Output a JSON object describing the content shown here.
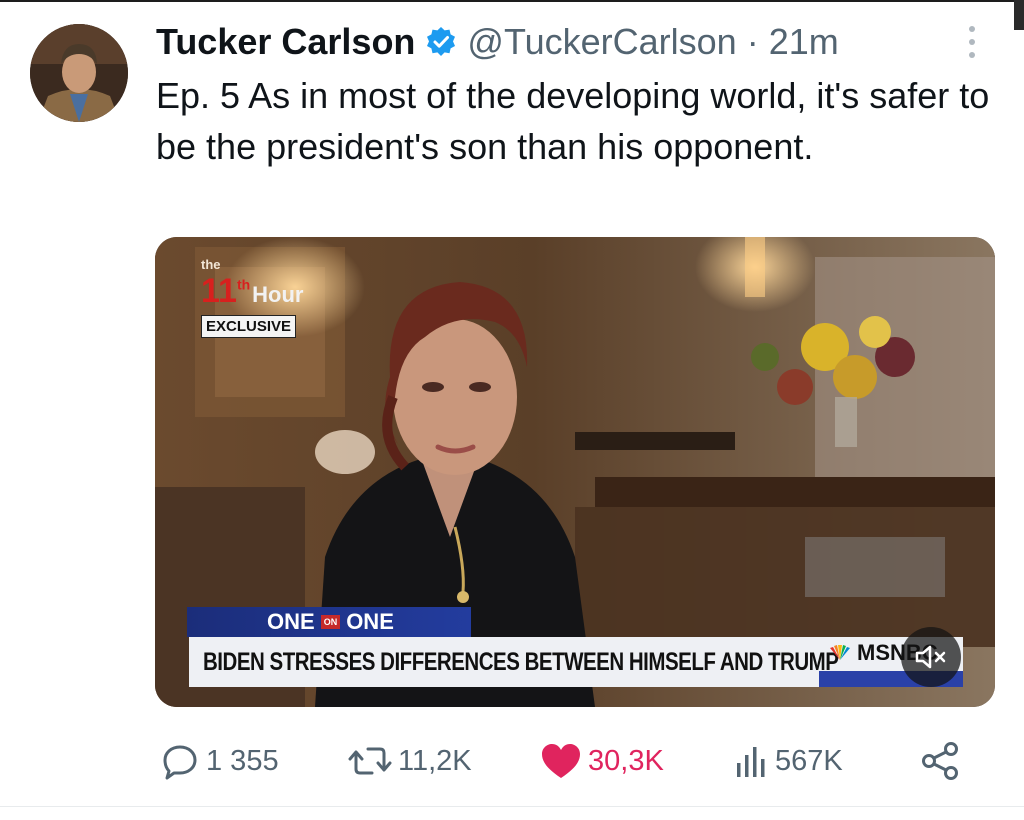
{
  "tweet": {
    "author_name": "Tucker Carlson",
    "handle_time": "@TuckerCarlson · 21m",
    "text": "Ep. 5  As in most of the developing world, it's safer to be the president's son than his opponent."
  },
  "video": {
    "logo_the": "the",
    "logo_number": "11",
    "logo_suffix": "th",
    "logo_hour": "Hour",
    "logo_badge": "EXCLUSIVE",
    "segment_word_left": "ONE",
    "segment_on": "ON",
    "segment_word_right": "ONE",
    "headline": "BIDEN STRESSES DIFFERENCES BETWEEN HIMSELF AND TRUMP",
    "network": "MSNBC"
  },
  "actions": {
    "replies": "1 355",
    "reposts": "11,2K",
    "likes": "30,3K",
    "views": "567K"
  },
  "colors": {
    "like": "#e0245e",
    "verified": "#1d9bf0",
    "muted_text": "#536471",
    "chyron_blue": "#233c9e"
  }
}
